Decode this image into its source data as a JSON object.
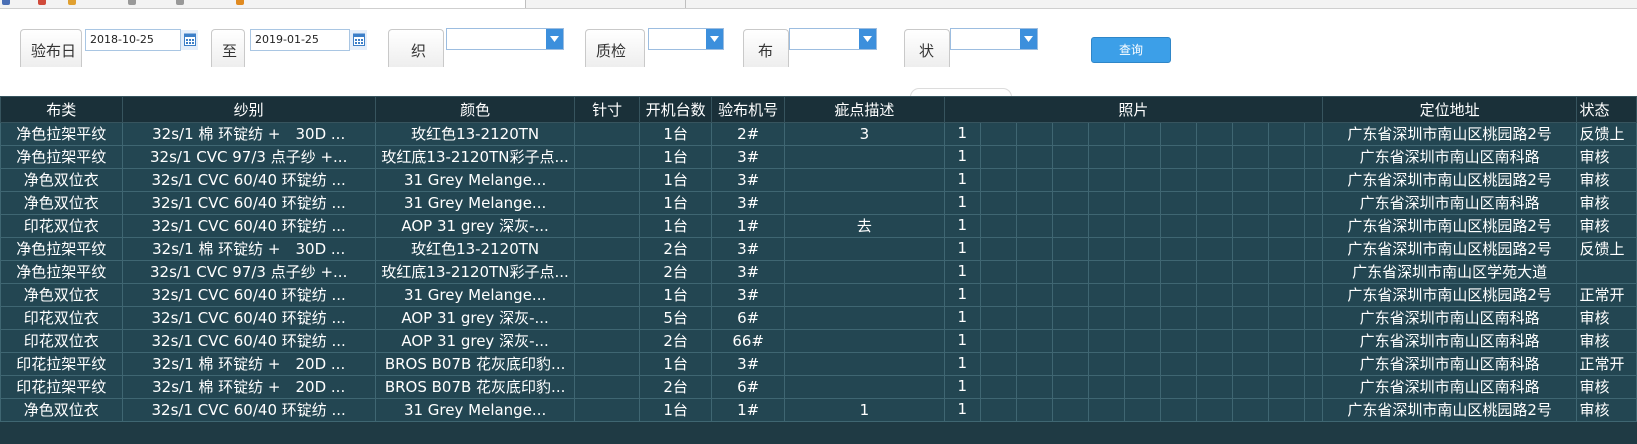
{
  "filters": {
    "date_label": "验布日",
    "date_from": "2018-10-25",
    "to_label": "至",
    "date_to": "2019-01-25",
    "org_label": "织",
    "qc_label": "质检",
    "fabric_label": "布",
    "status_label": "状",
    "query_button": "查询"
  },
  "table": {
    "columns": [
      "布类",
      "纱别",
      "颜色",
      "针寸",
      "开机台数",
      "验布机号",
      "疵点描述",
      "照片",
      "定位地址",
      "状态"
    ],
    "rows": [
      {
        "fabric": "净色拉架平纹",
        "yarn": "32s/1 棉 环锭纺 +　30D ...",
        "color": "玫红色13-2120TN",
        "gauge": "",
        "machines": "1台",
        "machine_no": "2#",
        "defect": "3",
        "photo": "1",
        "address": "广东省深圳市南山区桃园路2号",
        "status": "反馈上"
      },
      {
        "fabric": "净色拉架平纹",
        "yarn": "32s/1 CVC 97/3 点子纱 +...",
        "color": "玫红底13-2120TN彩子点...",
        "gauge": "",
        "machines": "1台",
        "machine_no": "3#",
        "defect": "",
        "photo": "1",
        "address": "广东省深圳市南山区南科路",
        "status": "审核"
      },
      {
        "fabric": "净色双位衣",
        "yarn": "32s/1 CVC 60/40 环锭纺 ...",
        "color": "31 Grey Melange...",
        "gauge": "",
        "machines": "1台",
        "machine_no": "3#",
        "defect": "",
        "photo": "1",
        "address": "广东省深圳市南山区桃园路2号",
        "status": "审核"
      },
      {
        "fabric": "净色双位衣",
        "yarn": "32s/1 CVC 60/40 环锭纺 ...",
        "color": "31 Grey Melange...",
        "gauge": "",
        "machines": "1台",
        "machine_no": "3#",
        "defect": "",
        "photo": "1",
        "address": "广东省深圳市南山区南科路",
        "status": "审核"
      },
      {
        "fabric": "印花双位衣",
        "yarn": "32s/1 CVC 60/40 环锭纺 ...",
        "color": "AOP 31 grey 深灰-...",
        "gauge": "",
        "machines": "1台",
        "machine_no": "1#",
        "defect": "去",
        "photo": "1",
        "address": "广东省深圳市南山区桃园路2号",
        "status": "审核"
      },
      {
        "fabric": "净色拉架平纹",
        "yarn": "32s/1 棉 环锭纺 +　30D ...",
        "color": "玫红色13-2120TN",
        "gauge": "",
        "machines": "2台",
        "machine_no": "3#",
        "defect": "",
        "photo": "1",
        "address": "广东省深圳市南山区桃园路2号",
        "status": "反馈上"
      },
      {
        "fabric": "净色拉架平纹",
        "yarn": "32s/1 CVC 97/3 点子纱 +...",
        "color": "玫红底13-2120TN彩子点...",
        "gauge": "",
        "machines": "2台",
        "machine_no": "3#",
        "defect": "",
        "photo": "1",
        "address": "广东省深圳市南山区学苑大道",
        "status": ""
      },
      {
        "fabric": "净色双位衣",
        "yarn": "32s/1 CVC 60/40 环锭纺 ...",
        "color": "31 Grey Melange...",
        "gauge": "",
        "machines": "1台",
        "machine_no": "3#",
        "defect": "",
        "photo": "1",
        "address": "广东省深圳市南山区桃园路2号",
        "status": "正常开"
      },
      {
        "fabric": "印花双位衣",
        "yarn": "32s/1 CVC 60/40 环锭纺 ...",
        "color": "AOP 31 grey 深灰-...",
        "gauge": "",
        "machines": "5台",
        "machine_no": "6#",
        "defect": "",
        "photo": "1",
        "address": "广东省深圳市南山区南科路",
        "status": "审核"
      },
      {
        "fabric": "印花双位衣",
        "yarn": "32s/1 CVC 60/40 环锭纺 ...",
        "color": "AOP 31 grey 深灰-...",
        "gauge": "",
        "machines": "2台",
        "machine_no": "66#",
        "defect": "",
        "photo": "1",
        "address": "广东省深圳市南山区南科路",
        "status": "审核"
      },
      {
        "fabric": "印花拉架平纹",
        "yarn": "32s/1 棉 环锭纺 +　20D ...",
        "color": "BROS B07B 花灰底印豹...",
        "gauge": "",
        "machines": "1台",
        "machine_no": "3#",
        "defect": "",
        "photo": "1",
        "address": "广东省深圳市南山区南科路",
        "status": "正常开"
      },
      {
        "fabric": "印花拉架平纹",
        "yarn": "32s/1 棉 环锭纺 +　20D ...",
        "color": "BROS B07B 花灰底印豹...",
        "gauge": "",
        "machines": "2台",
        "machine_no": "6#",
        "defect": "",
        "photo": "1",
        "address": "广东省深圳市南山区南科路",
        "status": "审核"
      },
      {
        "fabric": "净色双位衣",
        "yarn": "32s/1 CVC 60/40 环锭纺 ...",
        "color": "31 Grey Melange...",
        "gauge": "",
        "machines": "1台",
        "machine_no": "1#",
        "defect": "1",
        "photo": "1",
        "address": "广东省深圳市南山区桃园路2号",
        "status": "审核"
      }
    ]
  },
  "colors": {
    "grid_bg": "#234652",
    "header_bg": "#1a3039",
    "grid_line": "#3f6672",
    "accent": "#3c8fdc",
    "query_bg": "#3c9fe8"
  }
}
